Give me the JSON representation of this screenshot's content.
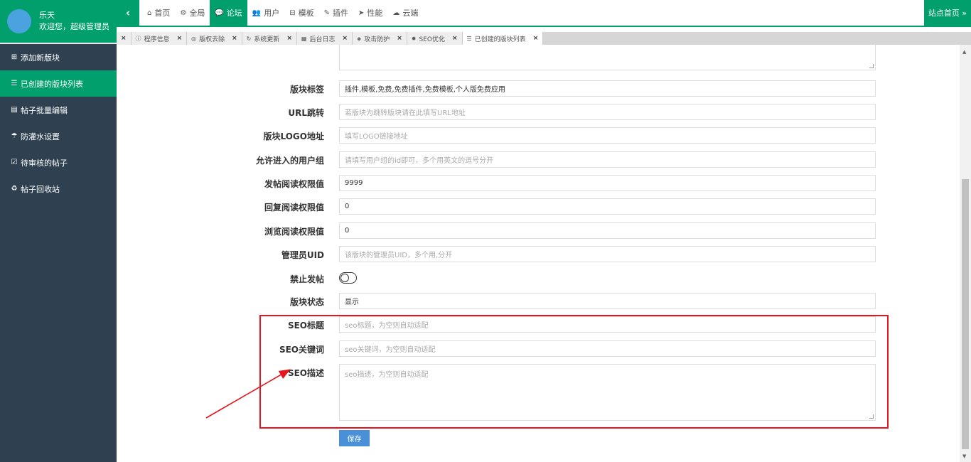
{
  "profile": {
    "name": "乐天",
    "welcome": "欢迎您，超级管理员"
  },
  "sidebar": {
    "items": [
      {
        "icon": "plus-square-icon",
        "glyph": "⊞",
        "label": "添加新版块"
      },
      {
        "icon": "list-icon",
        "glyph": "☰",
        "label": "已创建的版块列表",
        "active": true
      },
      {
        "icon": "table-edit-icon",
        "glyph": "▤",
        "label": "帖子批量编辑"
      },
      {
        "icon": "umbrella-icon",
        "glyph": "☂",
        "label": "防灌水设置"
      },
      {
        "icon": "check-square-icon",
        "glyph": "☑",
        "label": "待审核的帖子"
      },
      {
        "icon": "recycle-icon",
        "glyph": "♻",
        "label": "帖子回收站"
      }
    ]
  },
  "topnav": {
    "collapse_glyph": "‹",
    "items": [
      {
        "icon": "home-icon",
        "glyph": "⌂",
        "label": "首页"
      },
      {
        "icon": "cogs-icon",
        "glyph": "⚙",
        "label": "全局"
      },
      {
        "icon": "comments-icon",
        "glyph": "💬",
        "label": "论坛",
        "active": true
      },
      {
        "icon": "users-icon",
        "glyph": "👥",
        "label": "用户"
      },
      {
        "icon": "sitemap-icon",
        "glyph": "⊟",
        "label": "模板"
      },
      {
        "icon": "plug-icon",
        "glyph": "✎",
        "label": "插件"
      },
      {
        "icon": "send-icon",
        "glyph": "➤",
        "label": "性能"
      },
      {
        "icon": "cloud-icon",
        "glyph": "☁",
        "label": "云端"
      }
    ],
    "site_home": "站点首页 »"
  },
  "tabs": [
    {
      "icon": "info-icon",
      "glyph": "ⓘ",
      "label": "程序信息"
    },
    {
      "icon": "copyright-icon",
      "glyph": "◎",
      "label": "版权去除"
    },
    {
      "icon": "refresh-icon",
      "glyph": "↻",
      "label": "系统更新"
    },
    {
      "icon": "calendar-icon",
      "glyph": "▦",
      "label": "后台日志"
    },
    {
      "icon": "shield-icon",
      "glyph": "◈",
      "label": "攻击防护"
    },
    {
      "icon": "gear-icon",
      "glyph": "✹",
      "label": "SEO优化"
    },
    {
      "icon": "list-icon",
      "glyph": "☰",
      "label": "已创建的版块列表",
      "active": true
    }
  ],
  "tab_close": "×",
  "form": {
    "tags_label": "版块标签",
    "tags_value": "插件,模板,免费,免费插件,免费模板,个人版免费应用",
    "url_label": "URL跳转",
    "url_placeholder": "若版块为跳转版块请在此填写URL地址",
    "logo_label": "版块LOGO地址",
    "logo_placeholder": "填写LOGO链接地址",
    "groups_label": "允许进入的用户组",
    "groups_placeholder": "请填写用户组的id即可，多个用英文的逗号分开",
    "post_read_label": "发帖阅读权限值",
    "post_read_value": "9999",
    "reply_read_label": "回复阅读权限值",
    "reply_read_value": "0",
    "browse_read_label": "浏览阅读权限值",
    "browse_read_value": "0",
    "admin_uid_label": "管理员UID",
    "admin_uid_placeholder": "该版块的管理员UID，多个用,分开",
    "no_post_label": "禁止发帖",
    "no_post_enabled": false,
    "status_label": "版块状态",
    "status_value": "显示",
    "seo_title_label": "SEO标题",
    "seo_title_placeholder": "seo标题，为空则自动适配",
    "seo_keywords_label": "SEO关键词",
    "seo_keywords_placeholder": "seo关键词，为空则自动适配",
    "seo_desc_label": "SEO描述",
    "seo_desc_placeholder": "seo描述，为空则自动适配",
    "save_label": "保存"
  },
  "annotation": {
    "highlight_color": "#e8141d",
    "arrow_color": "#e8141d"
  },
  "colors": {
    "accent": "#009f6b",
    "sidebar": "#2f4050",
    "primary_button": "#4a90d9"
  },
  "scrollbar": {
    "up": "▲",
    "down": "▼"
  }
}
